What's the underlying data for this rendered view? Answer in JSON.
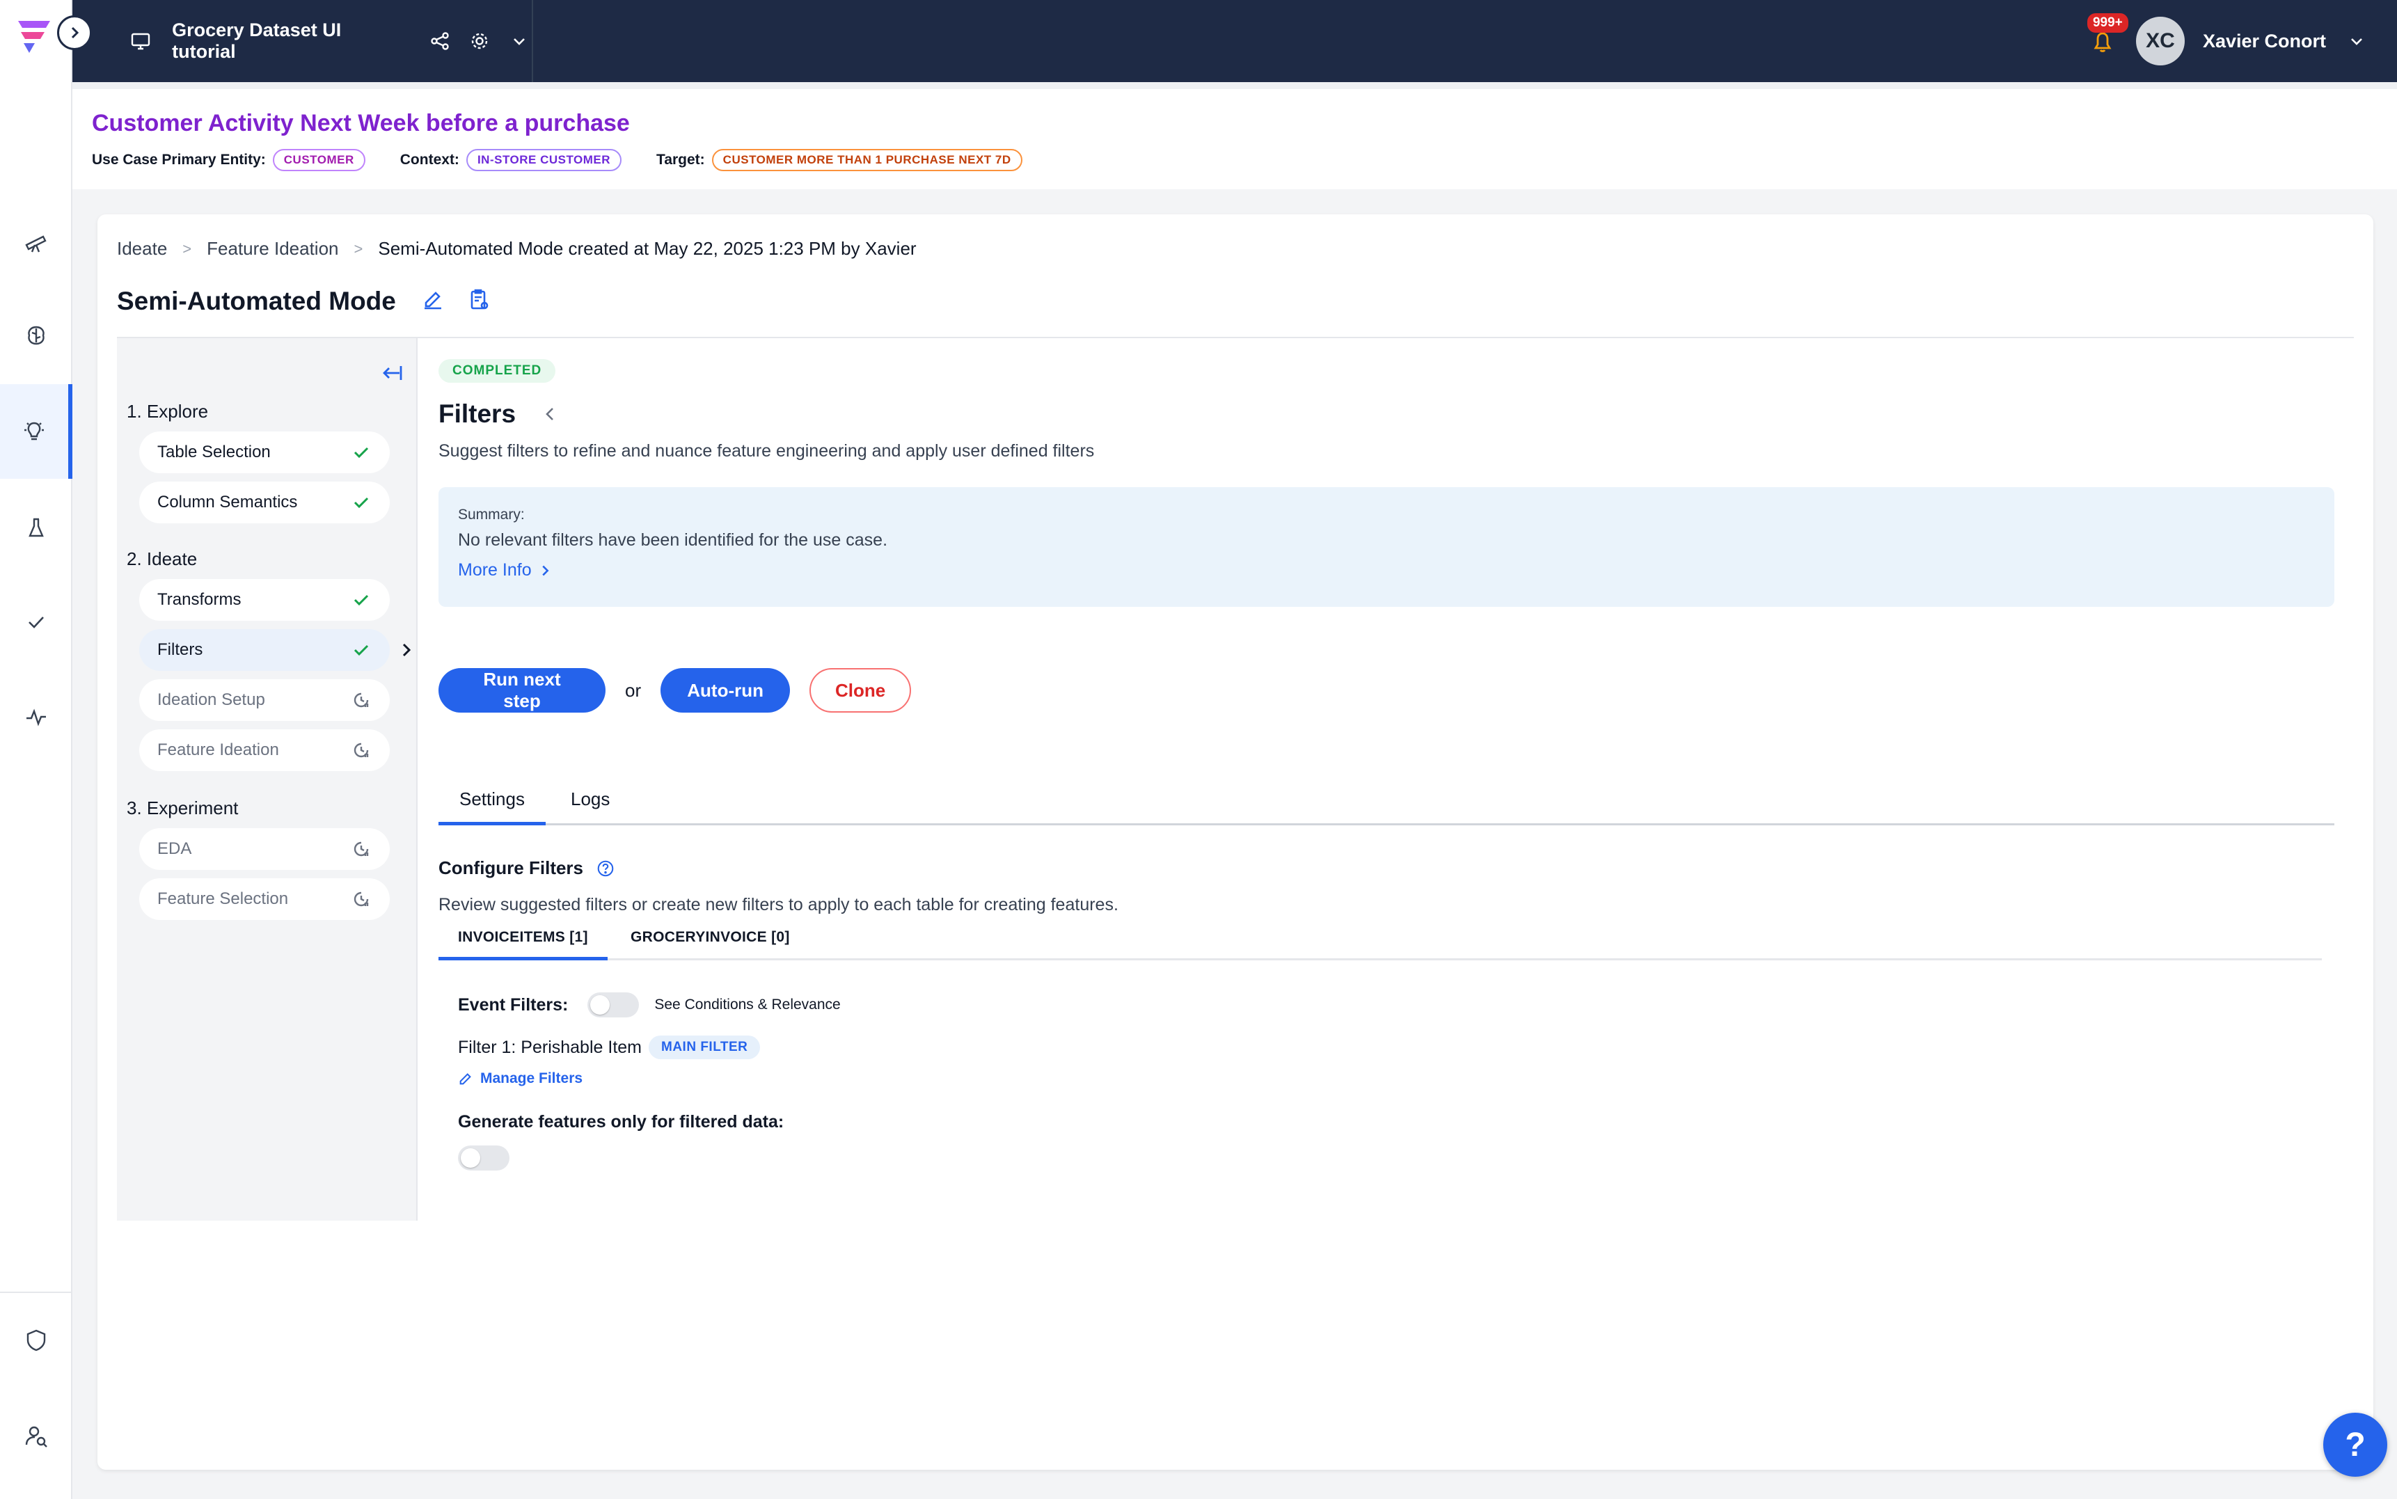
{
  "topbar": {
    "project_title": "Grocery Dataset UI tutorial",
    "notification_count": "999+",
    "user_initials": "XC",
    "user_name": "Xavier Conort"
  },
  "usecase": {
    "title": "Customer Activity Next Week before a purchase",
    "primary_entity_label": "Use Case Primary Entity:",
    "primary_entity": "CUSTOMER",
    "context_label": "Context:",
    "context": "IN-STORE CUSTOMER",
    "target_label": "Target:",
    "target": "CUSTOMER MORE THAN 1 PURCHASE NEXT 7D"
  },
  "breadcrumb": {
    "items": [
      "Ideate",
      "Feature Ideation"
    ],
    "separator": ">",
    "current": "Semi-Automated Mode created at May 22, 2025 1:23 PM by Xavier"
  },
  "mode_title": "Semi-Automated Mode",
  "steps": {
    "groups": [
      {
        "label": "1. Explore",
        "items": [
          {
            "label": "Table Selection",
            "status": "done"
          },
          {
            "label": "Column Semantics",
            "status": "done"
          }
        ]
      },
      {
        "label": "2. Ideate",
        "items": [
          {
            "label": "Transforms",
            "status": "done"
          },
          {
            "label": "Filters",
            "status": "done",
            "active": true
          },
          {
            "label": "Ideation Setup",
            "status": "pending"
          },
          {
            "label": "Feature Ideation",
            "status": "pending"
          }
        ]
      },
      {
        "label": "3. Experiment",
        "items": [
          {
            "label": "EDA",
            "status": "pending"
          },
          {
            "label": "Feature Selection",
            "status": "pending"
          }
        ]
      }
    ]
  },
  "content": {
    "status": "COMPLETED",
    "title": "Filters",
    "subtitle": "Suggest filters to refine and nuance feature engineering and apply user defined filters",
    "summary": {
      "label": "Summary:",
      "text": "No relevant filters have been identified for the use case.",
      "more_info": "More Info"
    },
    "buttons": {
      "run_next": "Run next step",
      "or": "or",
      "auto_run": "Auto-run",
      "clone": "Clone"
    },
    "tabs": [
      "Settings",
      "Logs"
    ],
    "configure": {
      "title": "Configure Filters",
      "subtitle": "Review suggested filters or create new filters to apply to each table for creating features.",
      "table_tabs": [
        "INVOICEITEMS [1]",
        "GROCERYINVOICE [0]"
      ],
      "event_filters_label": "Event Filters:",
      "see_conditions": "See Conditions & Relevance",
      "filter_name": "Filter 1: Perishable Item",
      "filter_badge": "MAIN FILTER",
      "manage_filters": "Manage Filters",
      "generate_label": "Generate features only for filtered data:"
    }
  },
  "help_label": "?",
  "colors": {
    "topbar": "#1e2a45",
    "accent": "#2563eb",
    "title_purple": "#7e22ce",
    "success": "#16a34a",
    "danger": "#dc2626"
  }
}
